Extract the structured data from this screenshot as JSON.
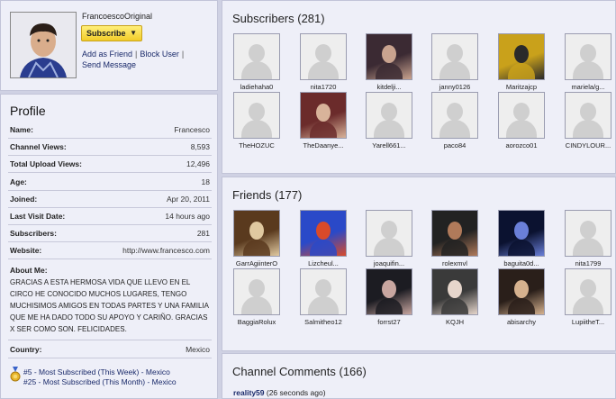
{
  "user": {
    "username": "FrancoescoOriginal",
    "subscribe_label": "Subscribe",
    "links": [
      "Add as Friend",
      "Block User",
      "Send Message"
    ]
  },
  "profile": {
    "title": "Profile",
    "rows": [
      {
        "k": "Name:",
        "v": "Francesco"
      },
      {
        "k": "Channel Views:",
        "v": "8,593"
      },
      {
        "k": "Total Upload Views:",
        "v": "12,496"
      },
      {
        "k": "Age:",
        "v": "18"
      },
      {
        "k": "Joined:",
        "v": "Apr 20, 2011"
      },
      {
        "k": "Last Visit Date:",
        "v": "14 hours ago"
      },
      {
        "k": "Subscribers:",
        "v": "281"
      },
      {
        "k": "Website:",
        "v": "http://www.francesco.com"
      }
    ],
    "about_label": "About Me:",
    "about_text": "GRACIAS A ESTA HERMOSA VIDA QUE LLEVO EN EL CIRCO HE CONOCIDO MUCHOS LUGARES, TENGO MUCHISIMOS AMIGOS EN TODAS PARTES Y UNA FAMILIA QUE ME HA DADO TODO SU APOYO Y CARIÑO. GRACIAS X SER COMO SON. FELICIDADES.",
    "country_label": "Country:",
    "country_value": "Mexico",
    "ranks": [
      "#5 - Most Subscribed (This Week) - Mexico",
      "#25 - Most Subscribed (This Month) - Mexico"
    ]
  },
  "subscribers": {
    "title": "Subscribers (281)",
    "items": [
      {
        "name": "ladiehaha0",
        "photo": false
      },
      {
        "name": "nita1720",
        "photo": false
      },
      {
        "name": "kitdelji...",
        "photo": true,
        "colors": [
          "#3b2a33",
          "#c9a38f"
        ]
      },
      {
        "name": "janny0126",
        "photo": false
      },
      {
        "name": "Maritzajcp",
        "photo": true,
        "colors": [
          "#c9a11b",
          "#2a2a2a"
        ]
      },
      {
        "name": "mariela/g...",
        "photo": false
      },
      {
        "name": "TheHOZUC",
        "photo": false
      },
      {
        "name": "TheDaanye...",
        "photo": true,
        "colors": [
          "#6b2b2b",
          "#d8b39a"
        ]
      },
      {
        "name": "Yarell661...",
        "photo": false
      },
      {
        "name": "paco84",
        "photo": false
      },
      {
        "name": "aorozco01",
        "photo": false
      },
      {
        "name": "CINDYLOUR...",
        "photo": false
      }
    ]
  },
  "friends": {
    "title": "Friends (177)",
    "items": [
      {
        "name": "GarrAgiinterO",
        "photo": true,
        "colors": [
          "#5a3a1e",
          "#e0c9a0"
        ]
      },
      {
        "name": "Lizcheul...",
        "photo": true,
        "colors": [
          "#2a49c8",
          "#d94a2a"
        ]
      },
      {
        "name": "joaquifin...",
        "photo": false
      },
      {
        "name": "rolexmvl",
        "photo": true,
        "colors": [
          "#222222",
          "#b07a5a"
        ]
      },
      {
        "name": "baguita0d...",
        "photo": true,
        "colors": [
          "#0b1230",
          "#6a7fd8"
        ]
      },
      {
        "name": "nita1799",
        "photo": false
      },
      {
        "name": "BaggiaRolux",
        "photo": false
      },
      {
        "name": "Salmitheo12",
        "photo": false
      },
      {
        "name": "forrst27",
        "photo": true,
        "colors": [
          "#1c1c22",
          "#c8a6a0"
        ]
      },
      {
        "name": "KQJH",
        "photo": true,
        "colors": [
          "#3a3a3a",
          "#e6d6cc"
        ]
      },
      {
        "name": "abisarchy",
        "photo": true,
        "colors": [
          "#2a1f1a",
          "#d6b28f"
        ]
      },
      {
        "name": "LupiitheT...",
        "photo": false
      }
    ]
  },
  "comments": {
    "title": "Channel Comments (166)",
    "first_user": "reality59",
    "first_time": "(26 seconds ago)"
  }
}
